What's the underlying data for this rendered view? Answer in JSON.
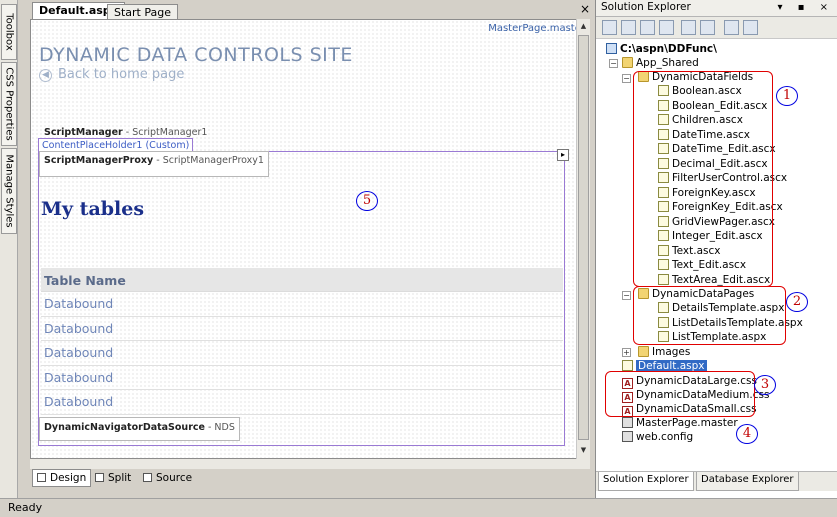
{
  "left_strip": {
    "tabs": [
      {
        "label": "Toolbox",
        "icon": "hammer-icon"
      },
      {
        "label": "CSS Properties",
        "icon": "css-icon"
      },
      {
        "label": "Manage Styles",
        "icon": "styles-icon"
      }
    ]
  },
  "document": {
    "tabs": [
      {
        "label": "Default.aspx",
        "active": true
      },
      {
        "label": "Start Page",
        "active": false
      }
    ],
    "close_glyph": "×",
    "master_label": "MasterPage.master",
    "site_title": "DYNAMIC DATA CONTROLS SITE",
    "back_link": "Back to home page",
    "back_arrow": "◀",
    "script_manager": {
      "name": "ScriptManager",
      "id": "- ScriptManager1"
    },
    "content_placeholder_label": "ContentPlaceHolder1 (Custom)",
    "smart_tag_glyph": "▸",
    "script_manager_proxy": {
      "name": "ScriptManagerProxy",
      "id": "- ScriptManagerProxy1"
    },
    "heading": "My tables",
    "grid": {
      "header": "Table Name",
      "rows": [
        "Databound",
        "Databound",
        "Databound",
        "Databound",
        "Databound"
      ]
    },
    "nav_data_source": {
      "name": "DynamicNavigatorDataSource",
      "id": "- NDS"
    },
    "callout_5": "5"
  },
  "view_tabs": [
    {
      "label": "Design",
      "active": true
    },
    {
      "label": "Split",
      "active": false
    },
    {
      "label": "Source",
      "active": false
    }
  ],
  "solution_explorer": {
    "title": "Solution Explorer",
    "title_icons": "▾ ▪ ×",
    "project": "C:\\aspn\\DDFunc\\",
    "app_shared": "App_Shared",
    "dynamic_data_fields": {
      "name": "DynamicDataFields",
      "files": [
        "Boolean.ascx",
        "Boolean_Edit.ascx",
        "Children.ascx",
        "DateTime.ascx",
        "DateTime_Edit.ascx",
        "Decimal_Edit.ascx",
        "FilterUserControl.ascx",
        "ForeignKey.ascx",
        "ForeignKey_Edit.ascx",
        "GridViewPager.ascx",
        "Integer_Edit.ascx",
        "Text.ascx",
        "Text_Edit.ascx",
        "TextArea_Edit.ascx"
      ]
    },
    "dynamic_data_pages": {
      "name": "DynamicDataPages",
      "files": [
        "DetailsTemplate.aspx",
        "ListDetailsTemplate.aspx",
        "ListTemplate.aspx"
      ]
    },
    "images_folder": "Images",
    "default_aspx": "Default.aspx",
    "css_files": [
      "DynamicDataLarge.css",
      "DynamicDataMedium.css",
      "DynamicDataSmall.css"
    ],
    "master_page": "MasterPage.master",
    "web_config": "web.config",
    "callouts": [
      "1",
      "2",
      "3",
      "4"
    ],
    "bottom_tabs": [
      {
        "label": "Solution Explorer",
        "active": true
      },
      {
        "label": "Database Explorer",
        "active": false
      }
    ]
  },
  "status": "Ready",
  "colors": {
    "annotation_red": "#e00000",
    "annotation_blue": "#0000e0",
    "selection": "#316ac5",
    "heading_blue": "#1a2f8a"
  }
}
